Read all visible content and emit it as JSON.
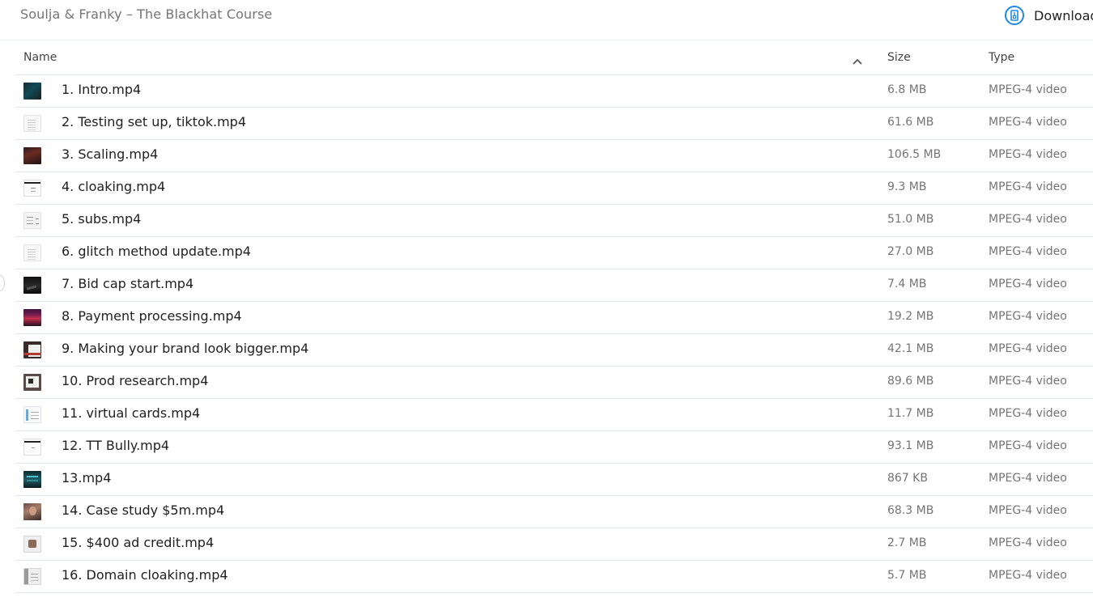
{
  "header": {
    "folder_title": "Soulja & Franky – The Blackhat Course",
    "download_label": "Download",
    "download_icon": "download-archive-icon",
    "accent_color": "#1e88e5"
  },
  "table": {
    "columns": {
      "name": "Name",
      "size": "Size",
      "type": "Type"
    },
    "sort": "name-ascending",
    "rows": [
      {
        "name": "1. Intro.mp4",
        "size": "6.8 MB",
        "type": "MPEG-4 video",
        "thumb": "t-dark-teal"
      },
      {
        "name": "2. Testing set up, tiktok.mp4",
        "size": "61.6 MB",
        "type": "MPEG-4 video",
        "thumb": "t-doc"
      },
      {
        "name": "3. Scaling.mp4",
        "size": "106.5 MB",
        "type": "MPEG-4 video",
        "thumb": "t-photo-red"
      },
      {
        "name": "4. cloaking.mp4",
        "size": "9.3 MB",
        "type": "MPEG-4 video",
        "thumb": "t-white-bar"
      },
      {
        "name": "5. subs.mp4",
        "size": "51.0 MB",
        "type": "MPEG-4 video",
        "thumb": "t-subs"
      },
      {
        "name": "6. glitch method update.mp4",
        "size": "27.0 MB",
        "type": "MPEG-4 video",
        "thumb": "t-doc"
      },
      {
        "name": "7. Bid cap start.mp4",
        "size": "7.4 MB",
        "type": "MPEG-4 video",
        "thumb": "t-black"
      },
      {
        "name": "8. Payment processing.mp4",
        "size": "19.2 MB",
        "type": "MPEG-4 video",
        "thumb": "t-purple"
      },
      {
        "name": "9. Making your brand look bigger.mp4",
        "size": "42.1 MB",
        "type": "MPEG-4 video",
        "thumb": "t-brand"
      },
      {
        "name": "10. Prod research.mp4",
        "size": "89.6 MB",
        "type": "MPEG-4 video",
        "thumb": "t-prod"
      },
      {
        "name": "11. virtual cards.mp4",
        "size": "11.7 MB",
        "type": "MPEG-4 video",
        "thumb": "t-cards"
      },
      {
        "name": "12. TT Bully.mp4",
        "size": "93.1 MB",
        "type": "MPEG-4 video",
        "thumb": "t-bully"
      },
      {
        "name": "13.mp4",
        "size": "867 KB",
        "type": "MPEG-4 video",
        "thumb": "t-teal2"
      },
      {
        "name": "14. Case study $5m.mp4",
        "size": "68.3 MB",
        "type": "MPEG-4 video",
        "thumb": "t-face"
      },
      {
        "name": "15. $400 ad credit.mp4",
        "size": "2.7 MB",
        "type": "MPEG-4 video",
        "thumb": "t-credit"
      },
      {
        "name": "16. Domain cloaking.mp4",
        "size": "5.7 MB",
        "type": "MPEG-4 video",
        "thumb": "t-domain"
      }
    ]
  }
}
